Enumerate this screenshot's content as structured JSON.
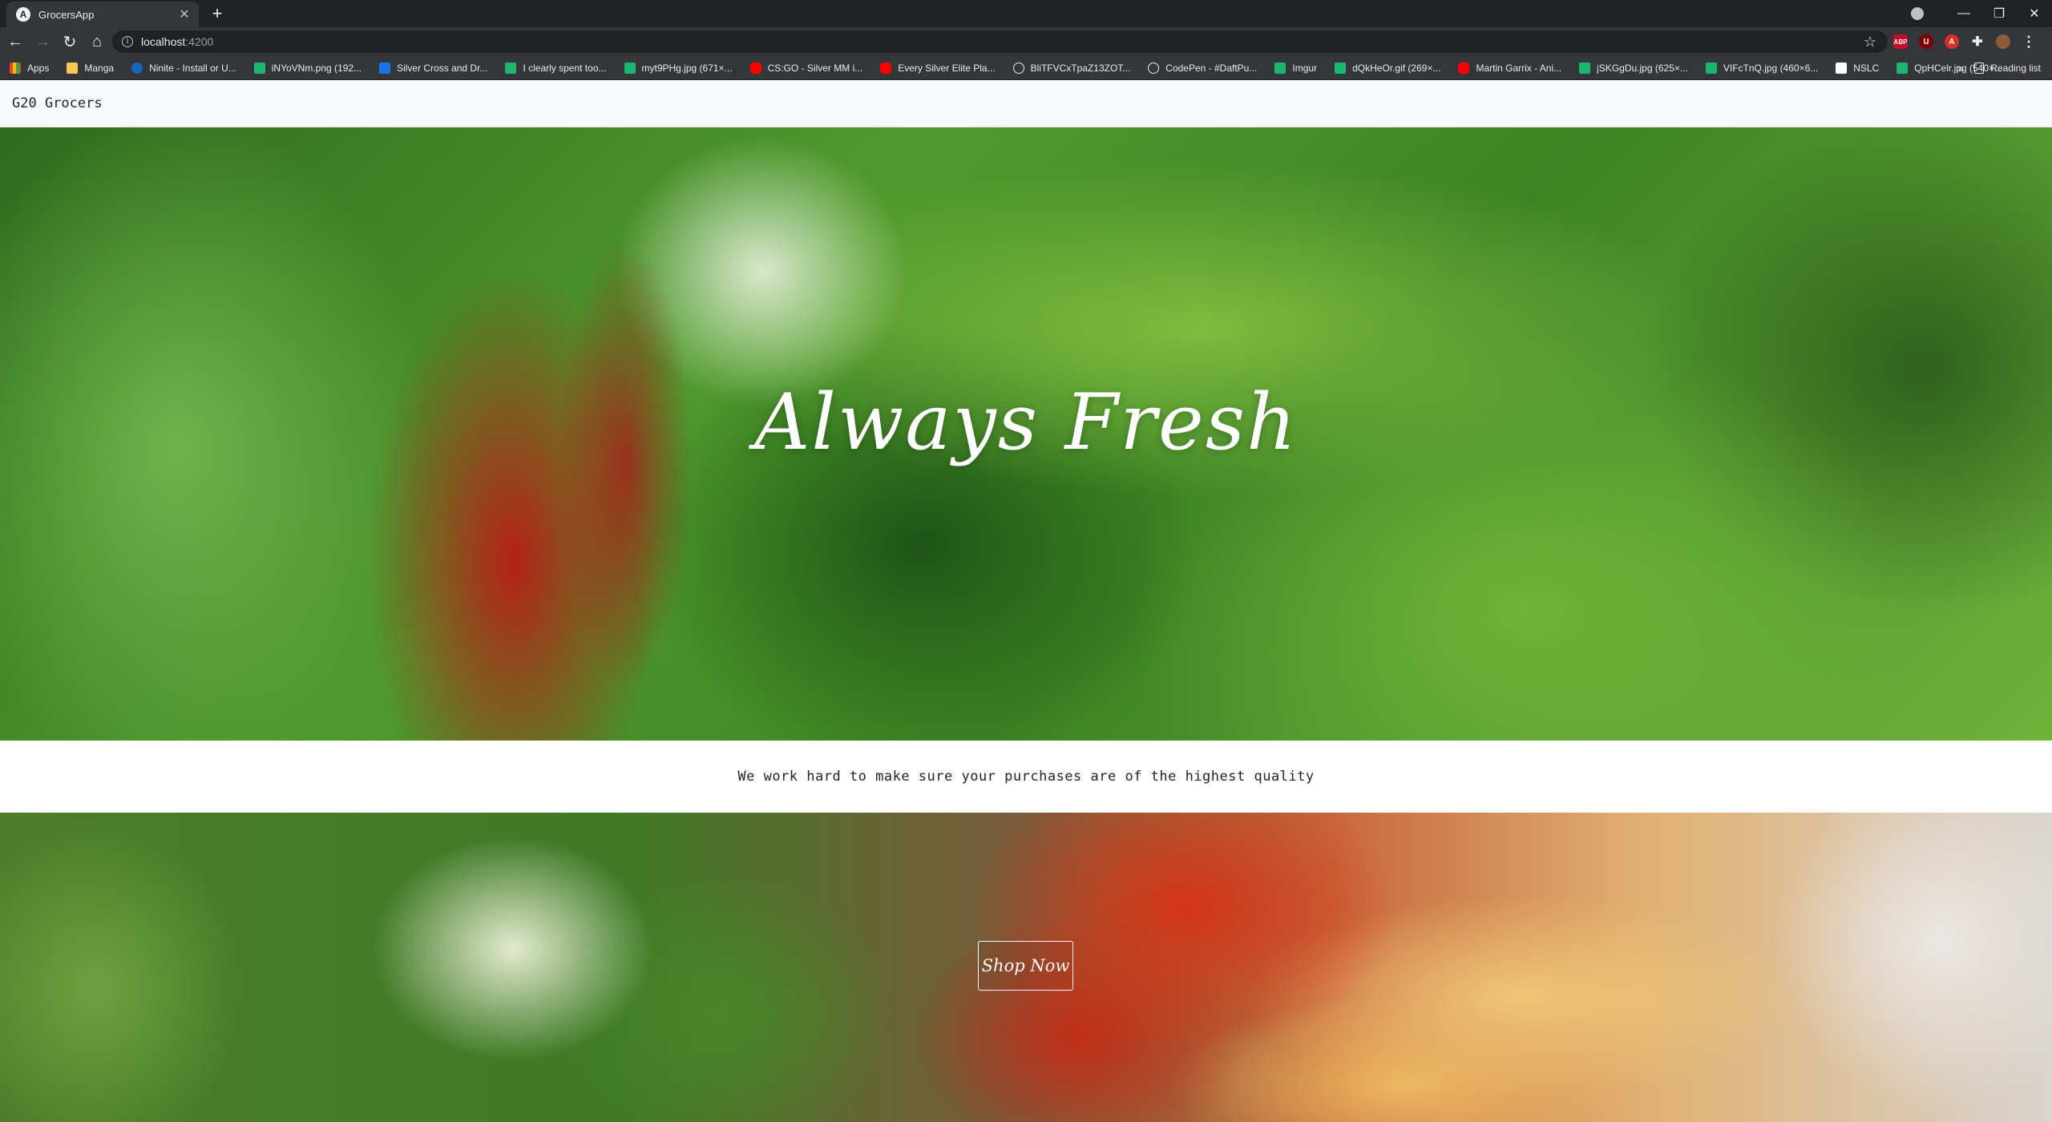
{
  "browser": {
    "tab_title": "GrocersApp",
    "tab_favicon": "A",
    "new_tab": "+",
    "address": {
      "host": "localhost",
      "port": ":4200"
    },
    "bookmarks": [
      {
        "label": "Apps",
        "icon": "apps-icon"
      },
      {
        "label": "Manga",
        "icon": "folder-icon"
      },
      {
        "label": "Ninite - Install or U...",
        "icon": "ninite-icon"
      },
      {
        "label": "iNYoVNm.png (192...",
        "icon": "imgur-icon"
      },
      {
        "label": "Silver Cross and Dr...",
        "icon": "blue-square-icon"
      },
      {
        "label": "I clearly spent too...",
        "icon": "imgur-icon"
      },
      {
        "label": "myt9PHg.jpg (671×...",
        "icon": "imgur-icon"
      },
      {
        "label": "CS:GO - Silver MM i...",
        "icon": "youtube-icon"
      },
      {
        "label": "Every Silver Elite Pla...",
        "icon": "youtube-icon"
      },
      {
        "label": "BliTFVCxTpaZ13ZOT...",
        "icon": "globe-icon"
      },
      {
        "label": "CodePen - #DaftPu...",
        "icon": "globe-icon"
      },
      {
        "label": "Imgur",
        "icon": "imgur-icon"
      },
      {
        "label": "dQkHeOr.gif (269×...",
        "icon": "imgur-icon"
      },
      {
        "label": "Martin Garrix - Ani...",
        "icon": "youtube-icon"
      },
      {
        "label": "jSKGgDu.jpg (625×...",
        "icon": "imgur-icon"
      },
      {
        "label": "VIFcTnQ.jpg (460×6...",
        "icon": "imgur-icon"
      },
      {
        "label": "NSLC",
        "icon": "blank-page-icon"
      },
      {
        "label": "QpHCelr.jpg (540×...",
        "icon": "imgur-icon"
      }
    ],
    "reading_list": "Reading list",
    "more": "»"
  },
  "app": {
    "brand": "G20 Grocers",
    "hero_title": "Always Fresh",
    "tagline": "We work hard to make sure your purchases are of the highest quality",
    "shop_button": "Shop Now"
  }
}
